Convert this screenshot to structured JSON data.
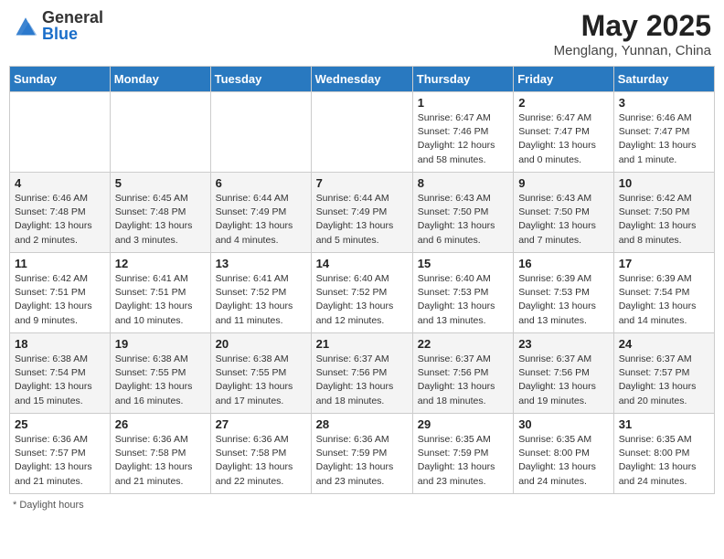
{
  "header": {
    "logo_general": "General",
    "logo_blue": "Blue",
    "month_year": "May 2025",
    "location": "Menglang, Yunnan, China"
  },
  "days_of_week": [
    "Sunday",
    "Monday",
    "Tuesday",
    "Wednesday",
    "Thursday",
    "Friday",
    "Saturday"
  ],
  "weeks": [
    [
      {
        "day": "",
        "info": ""
      },
      {
        "day": "",
        "info": ""
      },
      {
        "day": "",
        "info": ""
      },
      {
        "day": "",
        "info": ""
      },
      {
        "day": "1",
        "info": "Sunrise: 6:47 AM\nSunset: 7:46 PM\nDaylight: 12 hours and 58 minutes."
      },
      {
        "day": "2",
        "info": "Sunrise: 6:47 AM\nSunset: 7:47 PM\nDaylight: 13 hours and 0 minutes."
      },
      {
        "day": "3",
        "info": "Sunrise: 6:46 AM\nSunset: 7:47 PM\nDaylight: 13 hours and 1 minute."
      }
    ],
    [
      {
        "day": "4",
        "info": "Sunrise: 6:46 AM\nSunset: 7:48 PM\nDaylight: 13 hours and 2 minutes."
      },
      {
        "day": "5",
        "info": "Sunrise: 6:45 AM\nSunset: 7:48 PM\nDaylight: 13 hours and 3 minutes."
      },
      {
        "day": "6",
        "info": "Sunrise: 6:44 AM\nSunset: 7:49 PM\nDaylight: 13 hours and 4 minutes."
      },
      {
        "day": "7",
        "info": "Sunrise: 6:44 AM\nSunset: 7:49 PM\nDaylight: 13 hours and 5 minutes."
      },
      {
        "day": "8",
        "info": "Sunrise: 6:43 AM\nSunset: 7:50 PM\nDaylight: 13 hours and 6 minutes."
      },
      {
        "day": "9",
        "info": "Sunrise: 6:43 AM\nSunset: 7:50 PM\nDaylight: 13 hours and 7 minutes."
      },
      {
        "day": "10",
        "info": "Sunrise: 6:42 AM\nSunset: 7:50 PM\nDaylight: 13 hours and 8 minutes."
      }
    ],
    [
      {
        "day": "11",
        "info": "Sunrise: 6:42 AM\nSunset: 7:51 PM\nDaylight: 13 hours and 9 minutes."
      },
      {
        "day": "12",
        "info": "Sunrise: 6:41 AM\nSunset: 7:51 PM\nDaylight: 13 hours and 10 minutes."
      },
      {
        "day": "13",
        "info": "Sunrise: 6:41 AM\nSunset: 7:52 PM\nDaylight: 13 hours and 11 minutes."
      },
      {
        "day": "14",
        "info": "Sunrise: 6:40 AM\nSunset: 7:52 PM\nDaylight: 13 hours and 12 minutes."
      },
      {
        "day": "15",
        "info": "Sunrise: 6:40 AM\nSunset: 7:53 PM\nDaylight: 13 hours and 13 minutes."
      },
      {
        "day": "16",
        "info": "Sunrise: 6:39 AM\nSunset: 7:53 PM\nDaylight: 13 hours and 13 minutes."
      },
      {
        "day": "17",
        "info": "Sunrise: 6:39 AM\nSunset: 7:54 PM\nDaylight: 13 hours and 14 minutes."
      }
    ],
    [
      {
        "day": "18",
        "info": "Sunrise: 6:38 AM\nSunset: 7:54 PM\nDaylight: 13 hours and 15 minutes."
      },
      {
        "day": "19",
        "info": "Sunrise: 6:38 AM\nSunset: 7:55 PM\nDaylight: 13 hours and 16 minutes."
      },
      {
        "day": "20",
        "info": "Sunrise: 6:38 AM\nSunset: 7:55 PM\nDaylight: 13 hours and 17 minutes."
      },
      {
        "day": "21",
        "info": "Sunrise: 6:37 AM\nSunset: 7:56 PM\nDaylight: 13 hours and 18 minutes."
      },
      {
        "day": "22",
        "info": "Sunrise: 6:37 AM\nSunset: 7:56 PM\nDaylight: 13 hours and 18 minutes."
      },
      {
        "day": "23",
        "info": "Sunrise: 6:37 AM\nSunset: 7:56 PM\nDaylight: 13 hours and 19 minutes."
      },
      {
        "day": "24",
        "info": "Sunrise: 6:37 AM\nSunset: 7:57 PM\nDaylight: 13 hours and 20 minutes."
      }
    ],
    [
      {
        "day": "25",
        "info": "Sunrise: 6:36 AM\nSunset: 7:57 PM\nDaylight: 13 hours and 21 minutes."
      },
      {
        "day": "26",
        "info": "Sunrise: 6:36 AM\nSunset: 7:58 PM\nDaylight: 13 hours and 21 minutes."
      },
      {
        "day": "27",
        "info": "Sunrise: 6:36 AM\nSunset: 7:58 PM\nDaylight: 13 hours and 22 minutes."
      },
      {
        "day": "28",
        "info": "Sunrise: 6:36 AM\nSunset: 7:59 PM\nDaylight: 13 hours and 23 minutes."
      },
      {
        "day": "29",
        "info": "Sunrise: 6:35 AM\nSunset: 7:59 PM\nDaylight: 13 hours and 23 minutes."
      },
      {
        "day": "30",
        "info": "Sunrise: 6:35 AM\nSunset: 8:00 PM\nDaylight: 13 hours and 24 minutes."
      },
      {
        "day": "31",
        "info": "Sunrise: 6:35 AM\nSunset: 8:00 PM\nDaylight: 13 hours and 24 minutes."
      }
    ]
  ],
  "footer": {
    "note": "Daylight hours"
  }
}
